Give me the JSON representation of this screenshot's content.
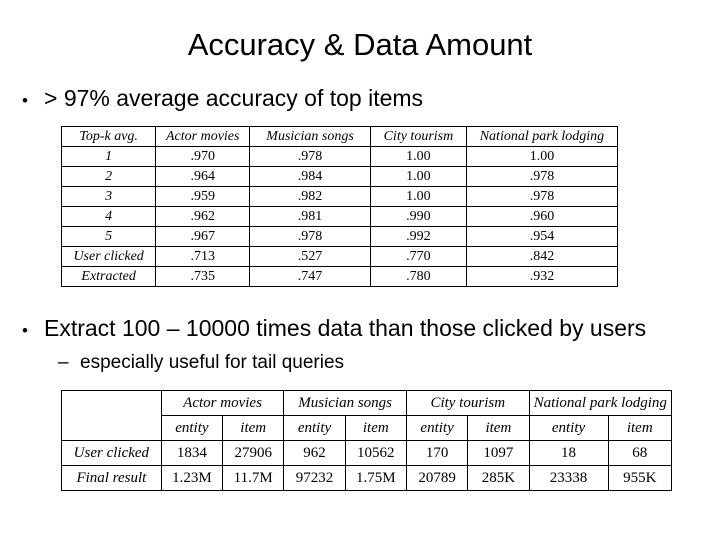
{
  "slide": {
    "title": "Accuracy & Data Amount",
    "bullet_marker": "•",
    "dash_marker": "–",
    "bullet_1": "> 97% average accuracy of top items",
    "bullet_2": "Extract 100 – 10000 times data than those clicked by users",
    "subbullet_1": "especially useful for tail queries"
  },
  "accuracy_table": {
    "headers": [
      "Top-k avg.",
      "Actor movies",
      "Musician songs",
      "City tourism",
      "National park lodging"
    ],
    "rows": [
      {
        "label": "1",
        "values": [
          ".970",
          ".978",
          "1.00",
          "1.00"
        ]
      },
      {
        "label": "2",
        "values": [
          ".964",
          ".984",
          "1.00",
          ".978"
        ]
      },
      {
        "label": "3",
        "values": [
          ".959",
          ".982",
          "1.00",
          ".978"
        ]
      },
      {
        "label": "4",
        "values": [
          ".962",
          ".981",
          ".990",
          ".960"
        ]
      },
      {
        "label": "5",
        "values": [
          ".967",
          ".978",
          ".992",
          ".954"
        ]
      },
      {
        "label": "User clicked",
        "values": [
          ".713",
          ".527",
          ".770",
          ".842"
        ]
      },
      {
        "label": "Extracted",
        "values": [
          ".735",
          ".747",
          ".780",
          ".932"
        ]
      }
    ]
  },
  "amount_table": {
    "corner": "",
    "groups": [
      "Actor movies",
      "Musician songs",
      "City tourism",
      "National park lodging"
    ],
    "subheaders": [
      "entity",
      "item",
      "entity",
      "item",
      "entity",
      "item",
      "entity",
      "item"
    ],
    "rows": [
      {
        "label": "User clicked",
        "values": [
          "1834",
          "27906",
          "962",
          "10562",
          "170",
          "1097",
          "18",
          "68"
        ]
      },
      {
        "label": "Final result",
        "values": [
          "1.23M",
          "11.7M",
          "97232",
          "1.75M",
          "20789",
          "285K",
          "23338",
          "955K"
        ]
      }
    ]
  }
}
